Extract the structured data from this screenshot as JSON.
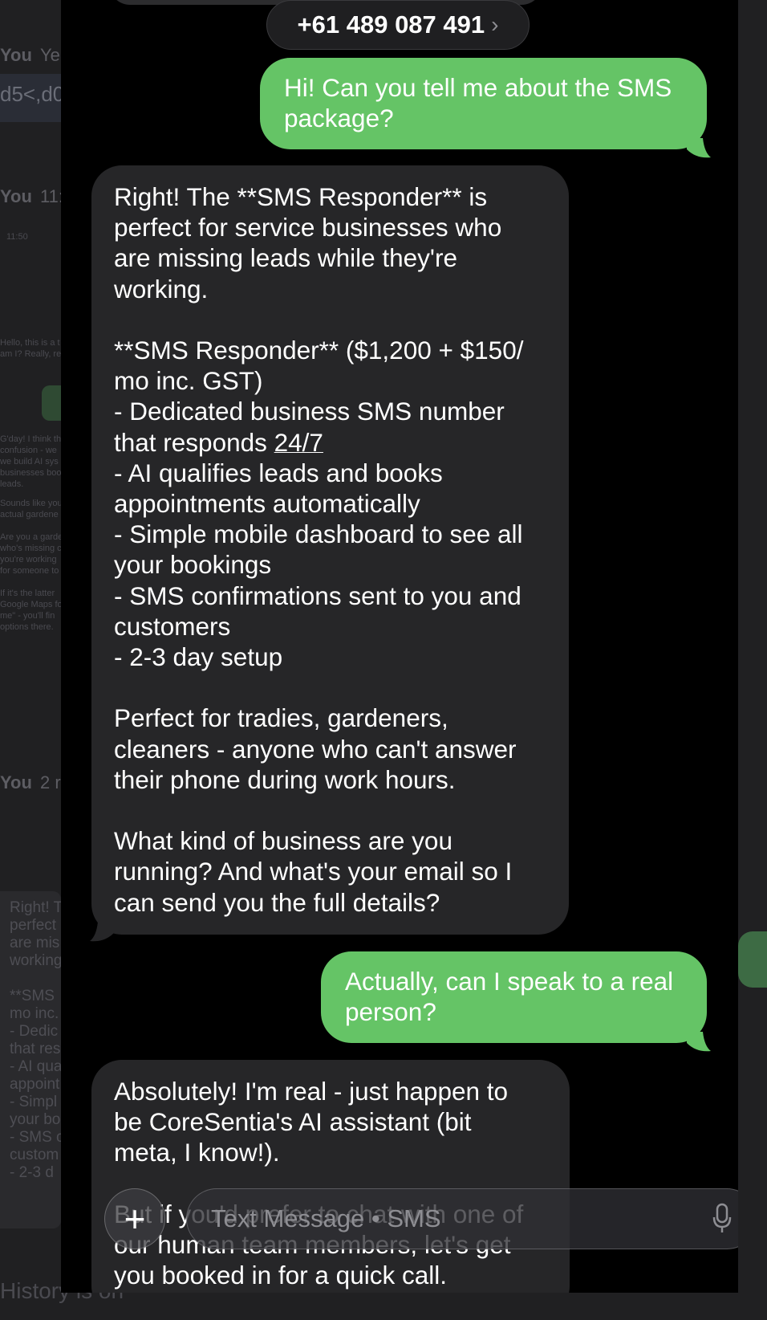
{
  "background_app": {
    "you_1": "You",
    "ye": "Ye",
    "code": "d5<,d0",
    "you_2": "You",
    "t_11": "11:",
    "time_small": "11:50",
    "you_3": "You",
    "n_2": "2 r",
    "snippet_a": "Hello, this is a t\nam I? Really, re",
    "snippet_b": "G'day! I think th\nconfusion - we\nwe build AI sys\nbusinesses boo\nleads.",
    "snippet_c": "Sounds like you\nactual gardene",
    "snippet_d": "Are you a garde\nwho's missing c\nyou're working\nfor someone to",
    "snippet_e": "If it's the latter\nGoogle Maps fo\nme\" - you'll fin\noptions there.",
    "block_text": "Right! T\nperfect\nare mis\nworking\n\n**SMS\nmo inc.\n- Dedic\nthat res\n- AI qua\nappoint\n- Simpl\nyour bo\n- SMS c\ncustom\n- 2-3 d",
    "footer": "History is on"
  },
  "header": {
    "phone_number": "+61 489 087 491",
    "chevron": "›"
  },
  "messages": [
    {
      "direction": "outgoing",
      "text": "Hi! Can you tell me about the SMS\npackage?"
    },
    {
      "direction": "incoming",
      "text_before": "Right! The **SMS Responder** is\nperfect for service businesses who\nare missing leads while they're\nworking.\n\n**SMS Responder** ($1,200 + $150/\nmo inc. GST)\n- Dedicated business SMS number\nthat responds ",
      "text_link": "24/7",
      "text_after": "\n- AI qualifies leads and books\nappointments automatically\n- Simple mobile dashboard to see all\nyour bookings\n- SMS confirmations sent to you and\ncustomers\n- 2-3 day setup\n\nPerfect for tradies, gardeners,\ncleaners - anyone who can't answer\ntheir phone during work hours.\n\nWhat kind of business are you\nrunning? And what's your email so I\ncan send you the full details?"
    },
    {
      "direction": "outgoing",
      "text": "Actually, can I speak to a real\nperson?"
    },
    {
      "direction": "incoming",
      "text": "Absolutely! I'm real - just happen to\nbe CoreSentia's AI assistant (bit\nmeta, I know!).\n\nBut if you'd prefer to chat with one of\nour human team members, let's get\nyou booked in for a quick call."
    }
  ],
  "composer": {
    "plus": "+",
    "placeholder": "Text Message • SMS"
  },
  "colors": {
    "outgoing_bubble": "#65c466",
    "incoming_bubble": "#262628",
    "background": "#000000"
  },
  "icons": [
    "plus-icon",
    "microphone-icon",
    "chevron-right-icon"
  ]
}
